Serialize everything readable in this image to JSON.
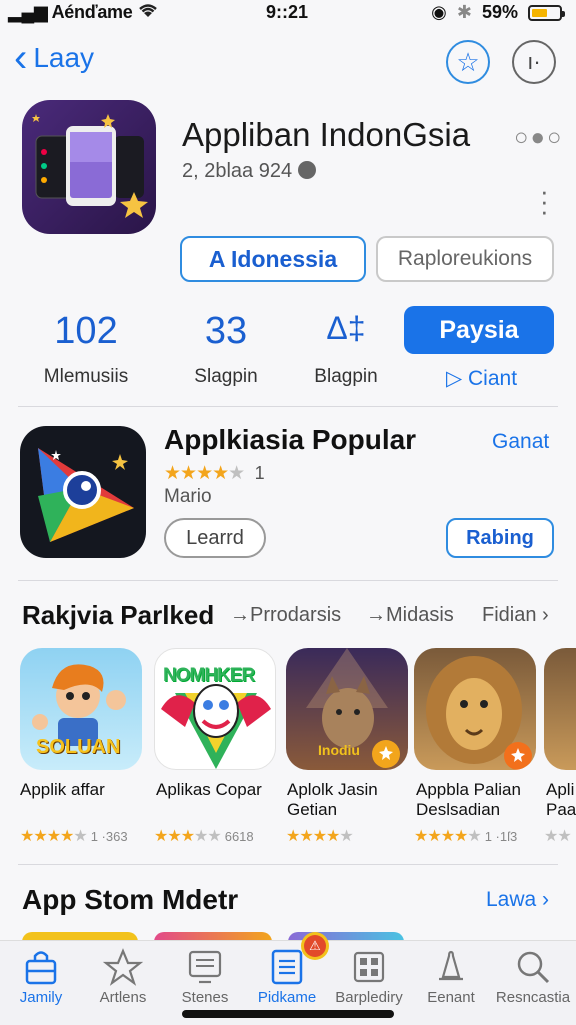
{
  "status": {
    "carrier": "Aénďame",
    "time": "9::21",
    "battery": "59%",
    "battery_level": 0.59
  },
  "nav": {
    "back_label": "Laay"
  },
  "app": {
    "title": "Appliban IndonGsia",
    "subtitle": "2, 2blaa 924",
    "btn_primary": "A Idonessia",
    "btn_secondary": "Raploreukions"
  },
  "stats": [
    {
      "value": "102",
      "label": "Mlemusiis"
    },
    {
      "value": "33",
      "label": "Slagpin"
    },
    {
      "value": "Δ‡",
      "label": "Blagpin"
    }
  ],
  "action": {
    "get_label": "Paysia",
    "link_label": "Ciant"
  },
  "popular": {
    "title": "Applkiasia Popular",
    "link": "Ganat",
    "rating_count": "1",
    "developer": "Mario",
    "btn_learn": "Learrd",
    "btn_rating": "Rabing",
    "stars": 4
  },
  "ranked": {
    "title": "Rakjvia Parlked",
    "filters": [
      "Prrodarsis",
      "Midasis",
      "Fidian"
    ],
    "items": [
      {
        "name": "Applik affar",
        "name2": "",
        "count": "1 ·363",
        "stars": 3.5
      },
      {
        "name": "Aplikas Copar",
        "name2": "",
        "count": "6618",
        "stars": 3
      },
      {
        "name": "Aplolk Jasin",
        "name2": "Getian",
        "count": "",
        "stars": 4
      },
      {
        "name": "Appbla Palian",
        "name2": "Deslsadian",
        "count": "1 ·1ſ3",
        "stars": 3.5
      },
      {
        "name": "Apli",
        "name2": "Paat",
        "count": "",
        "stars": 3
      }
    ],
    "tile_texts": {
      "t1": "SOLUAN",
      "t2": "NOMHKER",
      "t3": "Inodiu"
    }
  },
  "store": {
    "title": "App  Stom Mdetr",
    "link": "Lawa"
  },
  "tabs": [
    {
      "label": "Jamily",
      "icon": "bag-icon",
      "active": true
    },
    {
      "label": "Artlens",
      "icon": "star-icon",
      "active": false
    },
    {
      "label": "Stenes",
      "icon": "monitor-icon",
      "active": false
    },
    {
      "label": "Pidkame",
      "icon": "list-icon",
      "active": true
    },
    {
      "label": "Barplediry",
      "icon": "grid-icon",
      "active": false
    },
    {
      "label": "Eenant",
      "icon": "bell-icon",
      "active": false
    },
    {
      "label": "Resncastia",
      "icon": "search-icon",
      "active": false
    }
  ],
  "colors": {
    "accent": "#1a73e8",
    "star": "#f3a51c",
    "battery": "#f5b400"
  }
}
